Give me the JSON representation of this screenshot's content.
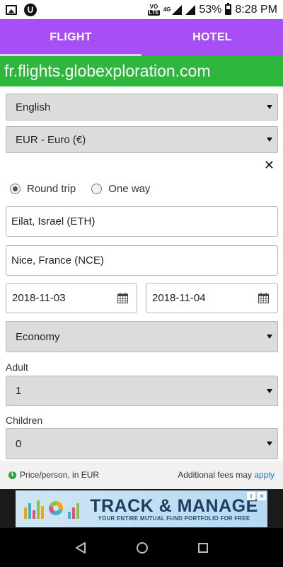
{
  "status_bar": {
    "network_label": "4G",
    "volte_label": "VoLTE",
    "volte_top": "VO",
    "volte_bottom": "LTE",
    "battery": "53%",
    "time": "8:28 PM"
  },
  "tabs": [
    {
      "label": "FLIGHT",
      "active": true
    },
    {
      "label": "HOTEL",
      "active": false
    }
  ],
  "domain": "fr.flights.globexploration.com",
  "form": {
    "language": "English",
    "currency": "EUR - Euro (€)",
    "close_symbol": "✕",
    "trip_types": [
      {
        "label": "Round trip",
        "selected": true
      },
      {
        "label": "One way",
        "selected": false
      }
    ],
    "origin": "Eilat, Israel (ETH)",
    "destination": "Nice, France (NCE)",
    "depart_date": "2018-11-03",
    "return_date": "2018-11-04",
    "cabin_class": "Economy",
    "adult_label": "Adult",
    "adult_value": "1",
    "children_label": "Children",
    "children_value": "0"
  },
  "info_bar": {
    "left_text": "Price/person, in EUR",
    "right_text": "Additional fees may",
    "link_text": "apply"
  },
  "ad": {
    "title": "TRACK & MANAGE",
    "subtitle": "YOUR ENTIRE MUTUAL FUND PORTFOLIO FOR FREE"
  },
  "colors": {
    "tab_bar": "#a64ff7",
    "domain_banner": "#2db83d",
    "link": "#1a73c9"
  },
  "icons": {
    "status_left": [
      "image-notification-icon",
      "u-app-icon"
    ],
    "status_right": [
      "volte-icon",
      "signal-icon",
      "battery-icon"
    ],
    "date_fields": "calendar-icon",
    "info": "info-icon",
    "nav": [
      "back-icon",
      "home-icon",
      "recents-icon"
    ]
  }
}
